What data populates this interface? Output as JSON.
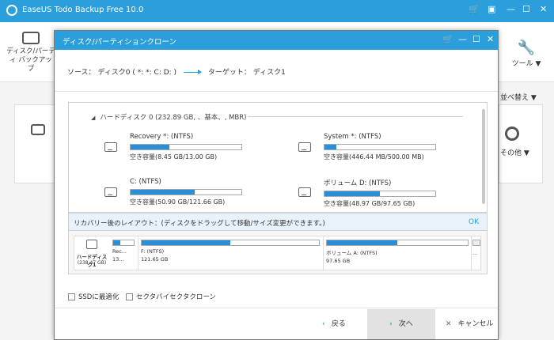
{
  "app": {
    "title": "EaseUS Todo Backup Free 10.0",
    "left_item_label": "ディスク/パーティ バックアップ",
    "tool_label": "ツール ▼",
    "sort_label": "並べ替え ▼",
    "other_label": "その他 ▼"
  },
  "dialog": {
    "title": "ディスク/パーティションクローン",
    "source_label": "ソース：",
    "source_value": "ディスク0 ( *: *: C: D: )",
    "target_label": "ターゲット：",
    "target_value": "ディスク1",
    "disk_header": "ハードディスク 0 (232.89 GB, 、基本、, MBR)",
    "partitions": [
      {
        "name": "Recovery *: (NTFS)",
        "free": "空き容量(8.45 GB/13.00 GB)",
        "used_fraction": 0.35
      },
      {
        "name": "System *: (NTFS)",
        "free": "空き容量(446.44 MB/500.00 MB)",
        "used_fraction": 0.11
      },
      {
        "name": "C: (NTFS)",
        "free": "空き容量(50.90 GB/121.66 GB)",
        "used_fraction": 0.58
      },
      {
        "name": "ボリューム D: (NTFS)",
        "free": "空き容量(48.97 GB/97.65 GB)",
        "used_fraction": 0.5
      }
    ],
    "layout_header": "リカバリー後のレイアウト：(ディスクをドラッグして移動/サイズ変更ができます。)",
    "layout_ok": "OK",
    "layout_disk_name": "ハードディスク1",
    "layout_disk_size": "(238.47 GB)",
    "layout_segments": [
      {
        "l1": "Rec...",
        "l2": "13...",
        "used_fraction": 0.35
      },
      {
        "l1": "F: (NTFS)",
        "l2": "121.65 GB",
        "used_fraction": 0.5
      },
      {
        "l1": "ボリューム A: (NTFS)",
        "l2": "97.65 GB",
        "used_fraction": 0.5
      },
      {
        "l1": "",
        "l2": "...",
        "used_fraction": 0
      }
    ],
    "check_ssd": "SSDに最適化",
    "check_sector": "セクタバイセクタクローン",
    "btn_back": "戻る",
    "btn_next": "次へ",
    "btn_cancel": "キャンセル"
  },
  "colors": {
    "accent": "#2a9fdb",
    "fill": "#2a8fd8"
  }
}
